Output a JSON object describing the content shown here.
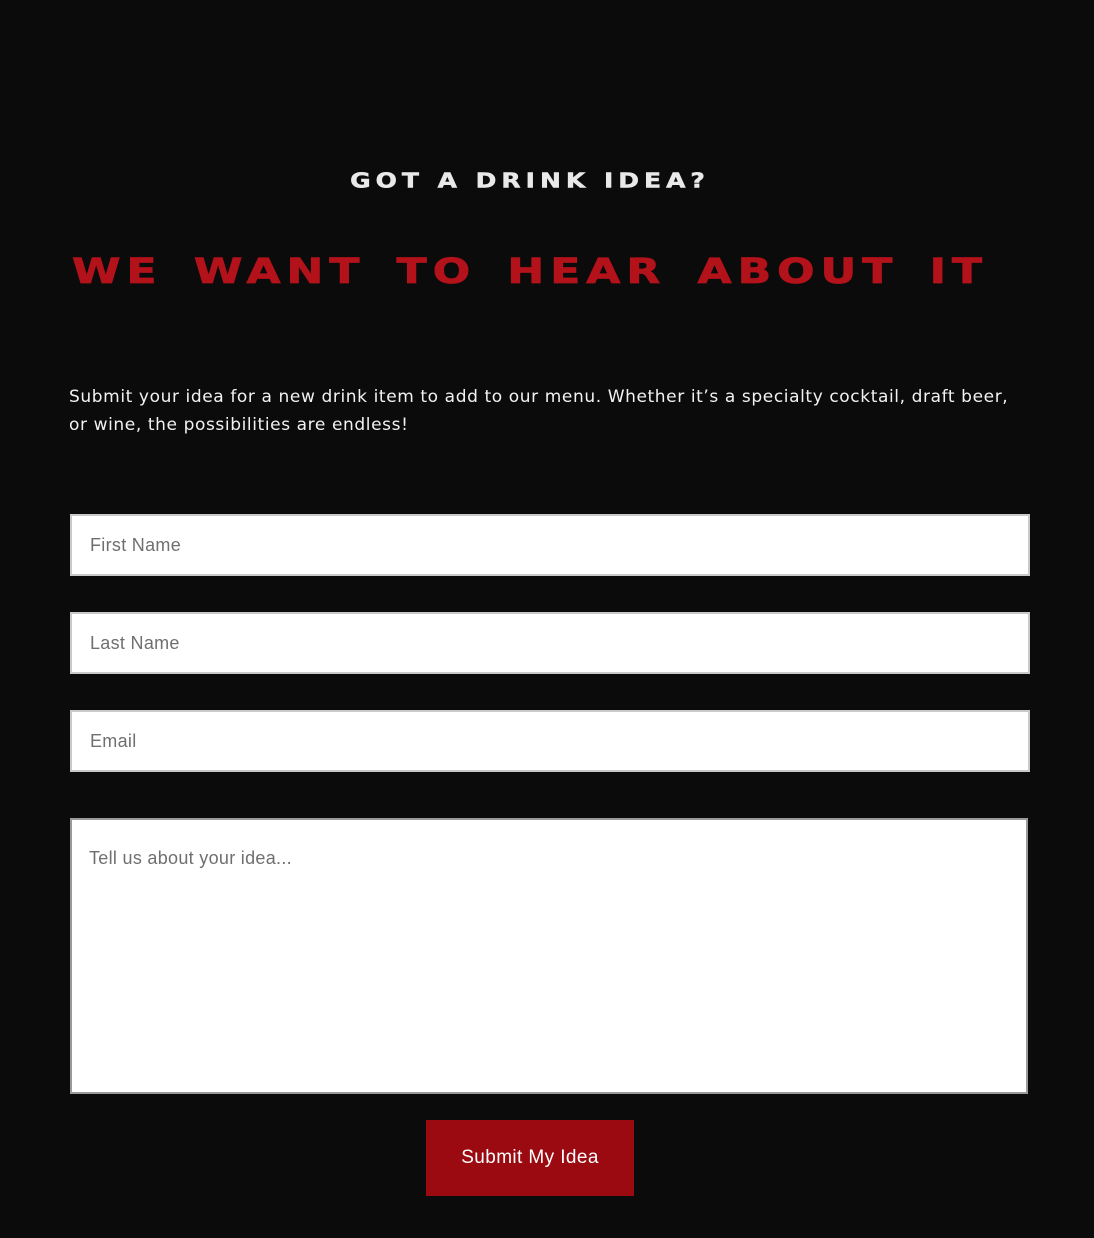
{
  "header": {
    "eyebrow": "GOT A DRINK IDEA?",
    "headline": "WE WANT TO HEAR ABOUT IT"
  },
  "intro": {
    "text": "Submit your idea for a new drink item to add to our menu. Whether it’s a specialty cocktail, draft beer, or wine, the possibilities are endless!"
  },
  "form": {
    "first_name": {
      "placeholder": "First Name",
      "value": ""
    },
    "last_name": {
      "placeholder": "Last Name",
      "value": ""
    },
    "email": {
      "placeholder": "Email",
      "value": ""
    },
    "idea": {
      "placeholder": "Tell us about your idea...",
      "value": ""
    },
    "submit_label": "Submit My Idea"
  },
  "colors": {
    "background": "#0b0b0b",
    "accent_red": "#b3121b",
    "button_red": "#9a0a10",
    "eyebrow_text": "#e9e9e9"
  }
}
